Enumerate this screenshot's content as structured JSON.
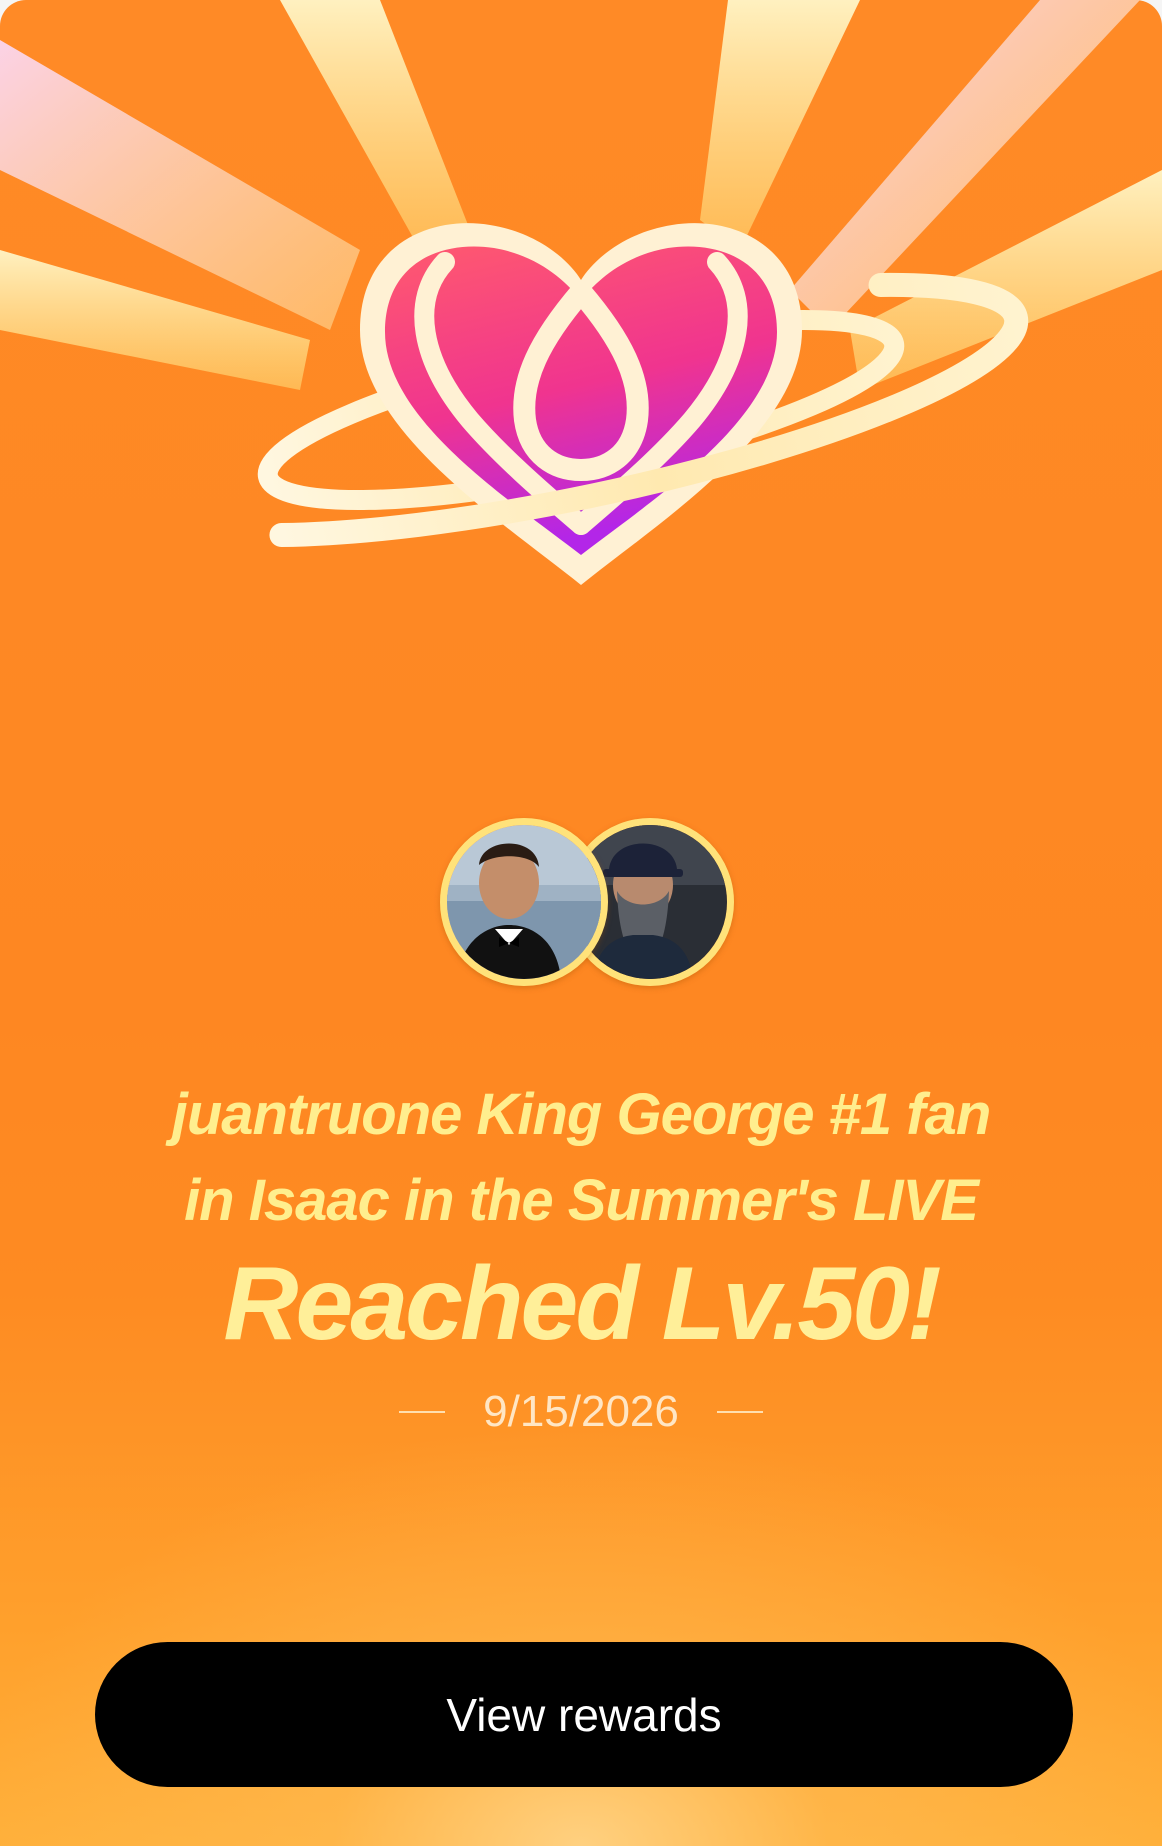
{
  "card": {
    "fan_line": "juantruone King George #1 fan",
    "live_line": "in Isaac in the Summer's LIVE",
    "level_line": "Reached Lv.50!",
    "date": "9/15/2026",
    "button_label": "View rewards"
  },
  "icons": {
    "hero": "heart-ring-icon",
    "avatars": [
      "avatar-user-photo",
      "avatar-host-photo"
    ]
  },
  "colors": {
    "background": "#fe8722",
    "title_text": "#ffee8e",
    "avatar_ring": "#ffe27a",
    "button": "#000000",
    "button_text": "#ffffff"
  }
}
